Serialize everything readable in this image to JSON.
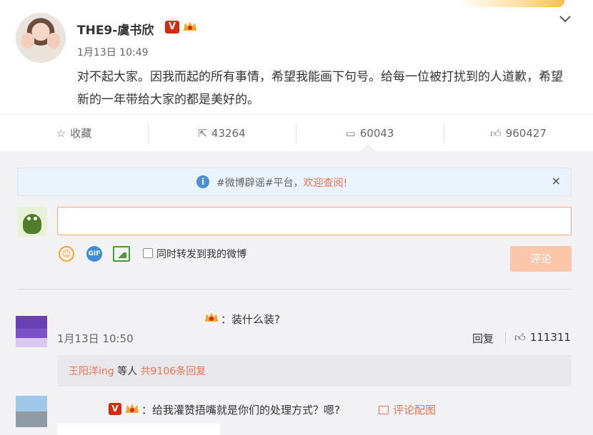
{
  "post": {
    "author": "THE9-虞书欣",
    "verified_badge": "V",
    "time": "1月13日 10:49",
    "text": "对不起大家。因我而起的所有事情，希望我能画下句号。给每一位被打扰到的人道歉，希望新的一年带给大家的都是美好的。"
  },
  "actions": {
    "collect_label": "收藏",
    "repost_count": "43264",
    "comment_count": "60043",
    "like_count": "960427"
  },
  "notice": {
    "prefix": "#微博辟谣#平台，",
    "link": "欢迎查阅!",
    "close": "×"
  },
  "composer": {
    "input_value": "",
    "repost_checkbox_label": "同时转发到我的微博",
    "submit_label": "评论",
    "gif_label": "GIF"
  },
  "comments": [
    {
      "text": "：装什么装?",
      "time": "1月13日 10:50",
      "reply_label": "回复",
      "like_count": "111311",
      "replies_user": "王阳洋ing",
      "replies_mid": " 等人 ",
      "replies_link": "共9106条回复"
    },
    {
      "verified_badge": "V",
      "text": "：给我灌赞捂嘴就是你们的处理方式？嗯?",
      "pic_label": "评论配图"
    }
  ],
  "colors": {
    "accent": "#eb7350",
    "verified": "#d9290c",
    "notice_bg": "#eaf2fb",
    "submit_disabled": "#fbc6aa"
  }
}
